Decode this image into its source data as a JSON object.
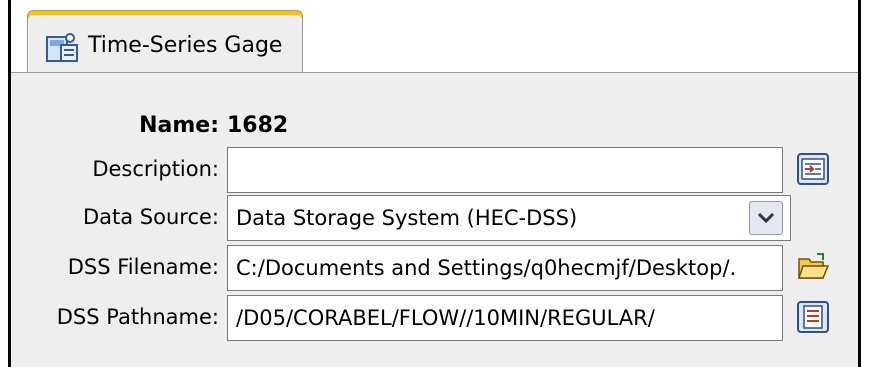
{
  "tab": {
    "label": "Time-Series Gage",
    "icon": "gage-icon"
  },
  "form": {
    "name_label": "Name:",
    "name_value": "1682",
    "description_label": "Description:",
    "description_value": "",
    "data_source_label": "Data Source:",
    "data_source_value": "Data Storage System (HEC-DSS)",
    "dss_filename_label": "DSS Filename:",
    "dss_filename_value": "C:/Documents and Settings/q0hecmjf/Desktop/.",
    "dss_pathname_label": "DSS Pathname:",
    "dss_pathname_value": "/D05/CORABEL/FLOW//10MIN/REGULAR/"
  },
  "colors": {
    "panel_bg": "#eeeeee",
    "tab_accent": "#ffc400",
    "field_border": "#7a7a7a"
  }
}
